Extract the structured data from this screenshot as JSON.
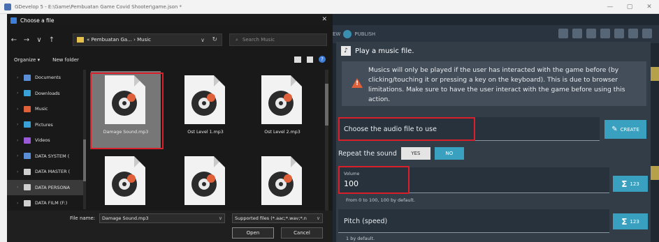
{
  "window": {
    "title": "GDevelop 5 - E:\\Game\\Pembuatan Game Covid Shooter\\game.json *",
    "minimize": "—",
    "maximize": "▢",
    "close": "✕"
  },
  "toolbar": {
    "preview_label": "EW",
    "publish_label": "PUBLISH"
  },
  "chooser": {
    "title": "Choose a file",
    "close": "✕",
    "nav": {
      "back": "←",
      "forward": "→",
      "recent": "∨",
      "up": "↑"
    },
    "breadcrumb": "« Pembuatan Ga... › Music",
    "address_dropdown": "∨",
    "refresh": "↻",
    "search_placeholder": "Search Music",
    "organize_label": "Organize ▾",
    "new_folder_label": "New folder",
    "help": "?",
    "nav_items": [
      {
        "label": "Documents",
        "color": "#5a8fd8"
      },
      {
        "label": "Downloads",
        "color": "#3aa0d8"
      },
      {
        "label": "Music",
        "color": "#e0603a"
      },
      {
        "label": "Pictures",
        "color": "#3aa0d8"
      },
      {
        "label": "Videos",
        "color": "#9a5ad8"
      },
      {
        "label": "DATA SYSTEM (",
        "color": "#5a8fd8"
      },
      {
        "label": "DATA MASTER (",
        "color": "#cfcfcf"
      },
      {
        "label": "DATA PERSONA",
        "color": "#cfcfcf"
      },
      {
        "label": "DATA FILM (F:)",
        "color": "#cfcfcf"
      }
    ],
    "files": [
      {
        "name": "Damage Sound.mp3"
      },
      {
        "name": "Ost Level 1.mp3"
      },
      {
        "name": "Ost Level 2.mp3"
      },
      {
        "name": ""
      },
      {
        "name": ""
      },
      {
        "name": ""
      }
    ],
    "file_name_label": "File name:",
    "file_name_value": "Damage Sound.mp3",
    "file_type_value": "Supported files (*.aac;*.wav;*.n",
    "open_label": "Open",
    "cancel_label": "Cancel"
  },
  "dialog": {
    "title": "Play a music file.",
    "warning": "Musics will only be played if the user has interacted with the game before (by clicking/touching it or pressing a key on the keyboard). This is due to browser limitations. Make sure to have the user interact with the game before using this action.",
    "audio_field_label": "Choose the audio file to use",
    "create_label": "CREATE",
    "repeat_label": "Repeat the sound",
    "yes_label": "YES",
    "no_label": "NO",
    "volume_label": "Volume",
    "volume_value": "100",
    "volume_helper": "From 0 to 100, 100 by default.",
    "pitch_label": "Pitch (speed)",
    "pitch_helper": "1 by default.",
    "sigma_label": "123"
  },
  "colors": {
    "accent": "#3aa0c0",
    "highlight": "#d9202a",
    "warning": "#e0603a"
  }
}
